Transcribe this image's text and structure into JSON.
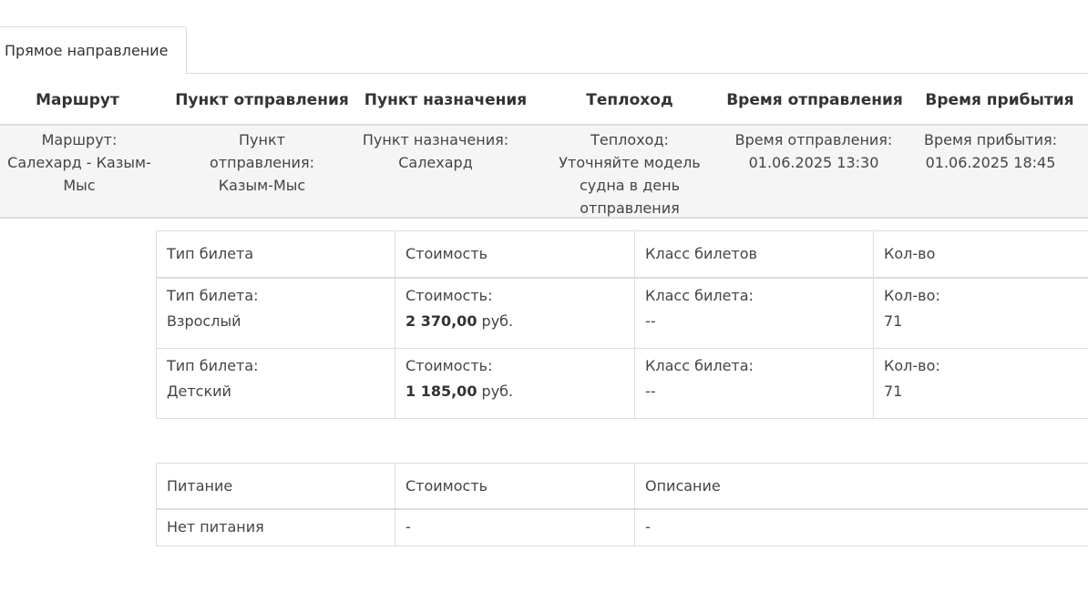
{
  "tabs": [
    {
      "label": "Прямое направление"
    }
  ],
  "route_header": [
    "Маршрут",
    "Пункт отправления",
    "Пункт назначения",
    "Теплоход",
    "Время отправления",
    "Время прибытия"
  ],
  "route_row": {
    "route_label": "Маршрут:",
    "route_value": "Салехард - Казым-Мыс",
    "departure_label": "Пункт отправления:",
    "departure_value": "Казым-Мыс",
    "destination_label": "Пункт назначения:",
    "destination_value": "Салехард",
    "ship_label": "Теплоход:",
    "ship_value": "Уточняйте модель судна в день отправления",
    "dep_time_label": "Время отправления:",
    "dep_time_value": "01.06.2025 13:30",
    "arr_time_label": "Время прибытия:",
    "arr_time_value": "01.06.2025 18:45"
  },
  "tickets": {
    "headers": [
      "Тип билета",
      "Стоимость",
      "Класс билетов",
      "Кол-во"
    ],
    "rows": [
      {
        "type_label": "Тип билета:",
        "type": "Взрослый",
        "price_label": "Стоимость:",
        "price": "2 370,00",
        "currency": "руб.",
        "class_label": "Класс билета:",
        "class": "--",
        "qty_label": "Кол-во:",
        "qty": "71"
      },
      {
        "type_label": "Тип билета:",
        "type": "Детский",
        "price_label": "Стоимость:",
        "price": "1 185,00",
        "currency": "руб.",
        "class_label": "Класс билета:",
        "class": "--",
        "qty_label": "Кол-во:",
        "qty": "71"
      }
    ]
  },
  "meals": {
    "headers": [
      "Питание",
      "Стоимость",
      "Описание"
    ],
    "rows": [
      {
        "name": "Нет питания",
        "price": "-",
        "description": "-"
      }
    ]
  }
}
